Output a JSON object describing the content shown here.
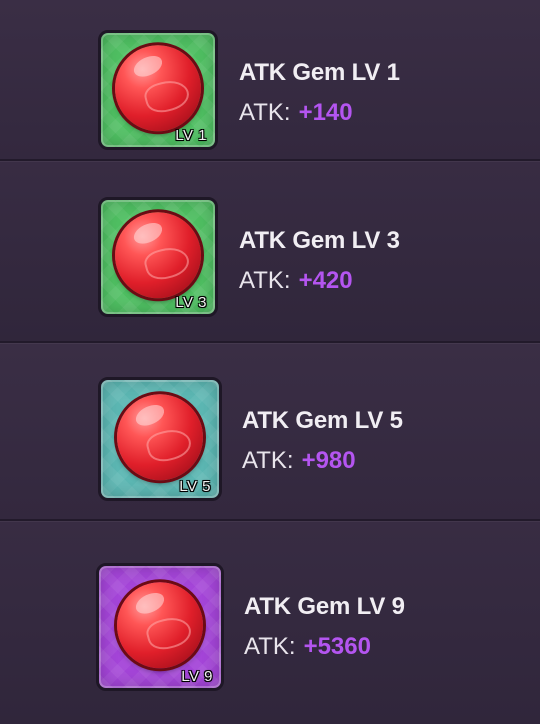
{
  "colors": {
    "background": "#34293e",
    "value_purple": "#b455f0",
    "text_light": "#f1eef3",
    "gem_red": "#e01f2a"
  },
  "gems": [
    {
      "name": "ATK Gem LV 1",
      "level_badge": "LV 1",
      "stat_label": "ATK:",
      "stat_value": "+140",
      "card_color": "#4fbf62",
      "icon": "red-gem-icon"
    },
    {
      "name": "ATK Gem LV 3",
      "level_badge": "LV 3",
      "stat_label": "ATK:",
      "stat_value": "+420",
      "card_color": "#4fbf62",
      "icon": "red-gem-icon"
    },
    {
      "name": "ATK Gem LV 5",
      "level_badge": "LV 5",
      "stat_label": "ATK:",
      "stat_value": "+980",
      "card_color": "#5cb7b3",
      "icon": "red-gem-icon"
    },
    {
      "name": "ATK Gem LV 9",
      "level_badge": "LV 9",
      "stat_label": "ATK:",
      "stat_value": "+5360",
      "card_color": "#a445d8",
      "icon": "red-gem-icon"
    }
  ]
}
